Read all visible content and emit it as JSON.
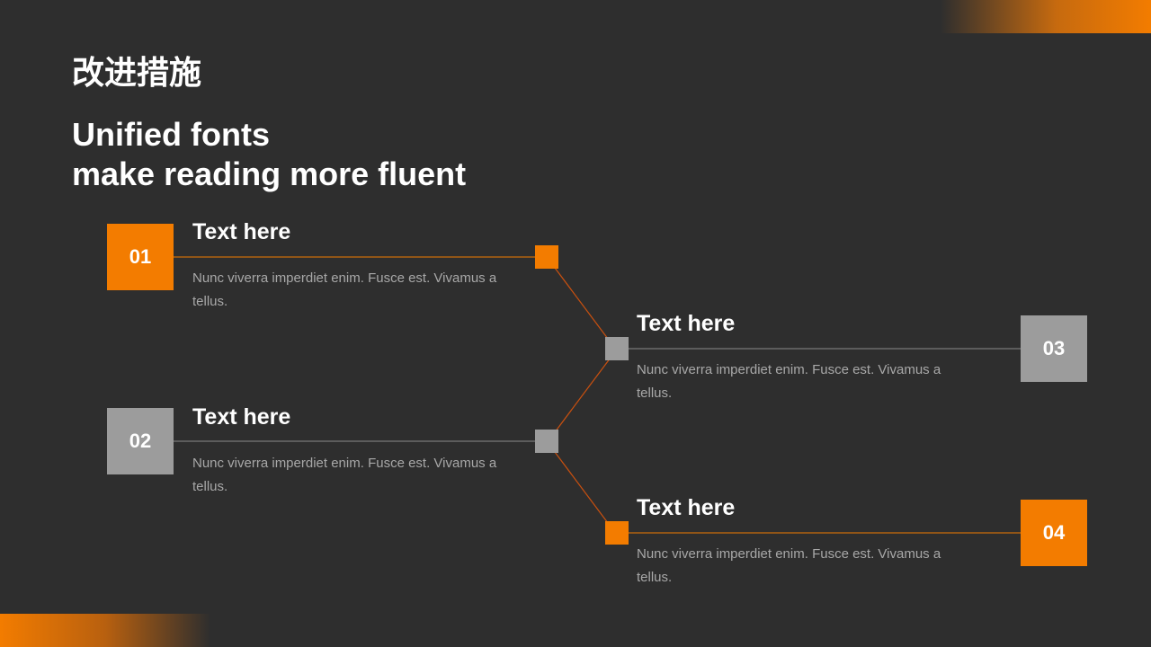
{
  "slide": {
    "title_cn": "改进措施",
    "subtitle_lines": [
      "Unified fonts",
      "make reading more fluent"
    ],
    "accent_color": "#f37c00",
    "secondary_color": "#9c9c9c",
    "background_color": "#2e2e2e"
  },
  "items": [
    {
      "number": "01",
      "title": "Text here",
      "desc": "Nunc viverra imperdiet enim. Fusce est. Vivamus a tellus.",
      "color": "orange"
    },
    {
      "number": "02",
      "title": "Text here",
      "desc": "Nunc viverra imperdiet enim. Fusce est. Vivamus a tellus.",
      "color": "gray"
    },
    {
      "number": "03",
      "title": "Text here",
      "desc": "Nunc viverra imperdiet enim. Fusce est. Vivamus a tellus.",
      "color": "gray"
    },
    {
      "number": "04",
      "title": "Text here",
      "desc": "Nunc viverra imperdiet enim. Fusce est. Vivamus a tellus.",
      "color": "orange"
    }
  ]
}
